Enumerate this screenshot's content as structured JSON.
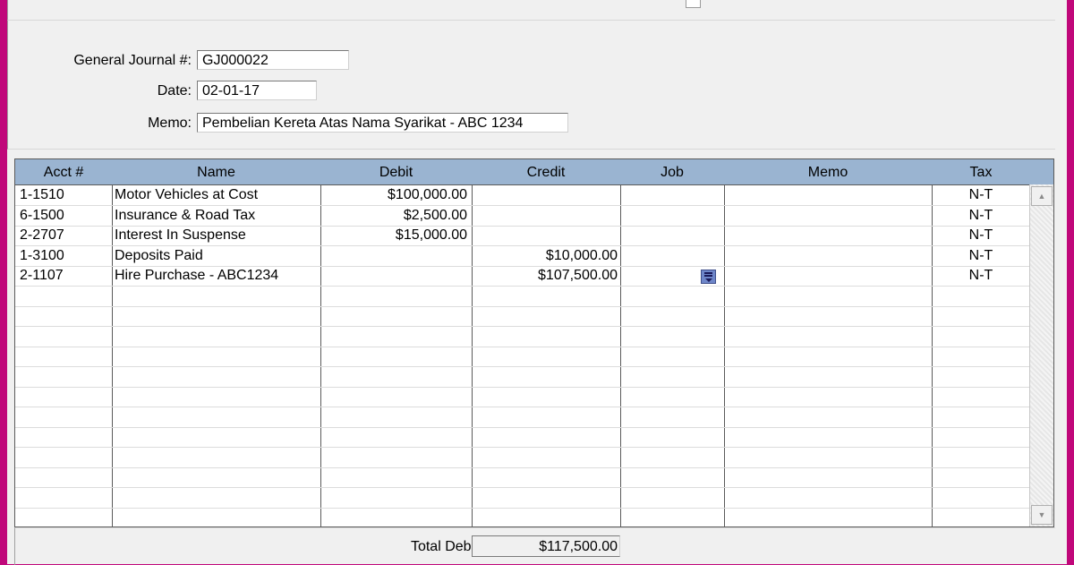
{
  "form": {
    "journal_label": "General Journal #:",
    "journal_value": "GJ000022",
    "date_label": "Date:",
    "date_value": "02-01-17",
    "memo_label": "Memo:",
    "memo_value": "Pembelian Kereta Atas Nama Syarikat - ABC 1234"
  },
  "grid": {
    "headers": [
      "Acct #",
      "Name",
      "Debit",
      "Credit",
      "Job",
      "Memo",
      "Tax"
    ],
    "rows": [
      {
        "acct": "1-1510",
        "name": "Motor Vehicles at Cost",
        "debit": "$100,000.00",
        "credit": "",
        "job": "",
        "memo": "",
        "tax": "N-T"
      },
      {
        "acct": "6-1500",
        "name": "Insurance & Road Tax",
        "debit": "$2,500.00",
        "credit": "",
        "job": "",
        "memo": "",
        "tax": "N-T"
      },
      {
        "acct": "2-2707",
        "name": "Interest In Suspense",
        "debit": "$15,000.00",
        "credit": "",
        "job": "",
        "memo": "",
        "tax": "N-T"
      },
      {
        "acct": "1-3100",
        "name": "Deposits Paid",
        "debit": "",
        "credit": "$10,000.00",
        "job": "",
        "memo": "",
        "tax": "N-T"
      },
      {
        "acct": "2-1107",
        "name": "Hire Purchase - ABC1234",
        "debit": "",
        "credit": "$107,500.00",
        "job": "",
        "memo": "",
        "tax": "N-T"
      }
    ],
    "job_dropdown_icon": "list-dropdown-icon"
  },
  "footer": {
    "total_debit_label": "Total Debit:",
    "total_debit_value": "$117,500.00"
  },
  "colors": {
    "frame_accent": "#c0077a",
    "header_bg": "#9ab4d1",
    "panel_bg": "#f0f0f0"
  }
}
